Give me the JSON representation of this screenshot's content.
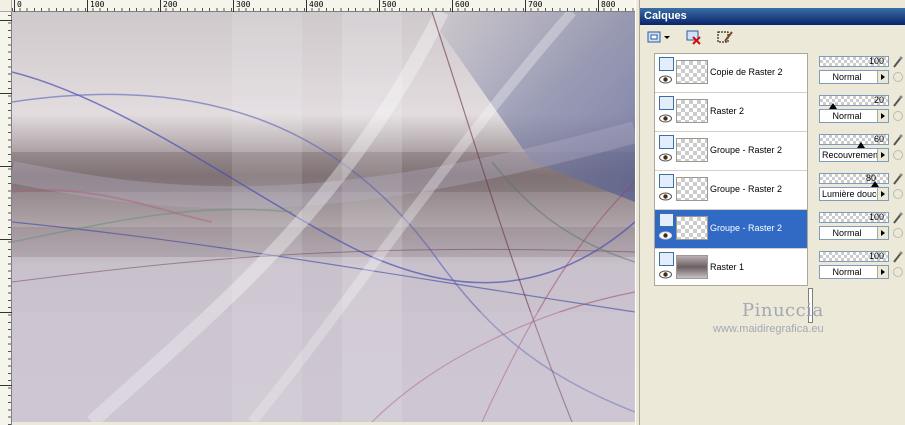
{
  "ruler": {
    "top_labels": [
      "0",
      "100",
      "200",
      "300",
      "400",
      "500",
      "600",
      "700",
      "800"
    ],
    "left_labels": [
      "0",
      "1",
      "2",
      "3",
      "4",
      "5",
      "6",
      "7",
      "8"
    ]
  },
  "palette": {
    "title": "Calques",
    "toolbar_icons": [
      "new-raster-layer-icon",
      "dropdown-arrow-icon",
      "delete-layer-icon",
      "edit-selection-icon"
    ]
  },
  "layers": [
    {
      "name": "Copie de Raster 2",
      "opacity": "100",
      "blend": "Normal",
      "selected": false
    },
    {
      "name": "Raster 2",
      "opacity": "20",
      "blend": "Normal",
      "selected": false
    },
    {
      "name": "Groupe - Raster 2",
      "opacity": "60",
      "blend": "Recouvrement",
      "selected": false
    },
    {
      "name": "Groupe - Raster 2",
      "opacity": "80",
      "blend": "Lumière douce",
      "selected": false
    },
    {
      "name": "Groupe - Raster 2",
      "opacity": "100",
      "blend": "Normal",
      "selected": true
    },
    {
      "name": "Raster 1",
      "opacity": "100",
      "blend": "Normal",
      "selected": false
    }
  ],
  "watermark": {
    "name": "Pinuccia",
    "url": "www.maidiregrafica.eu"
  },
  "colors": {
    "title_bar": "#0a246a",
    "selection": "#316ac5",
    "panel": "#ece9d8"
  }
}
